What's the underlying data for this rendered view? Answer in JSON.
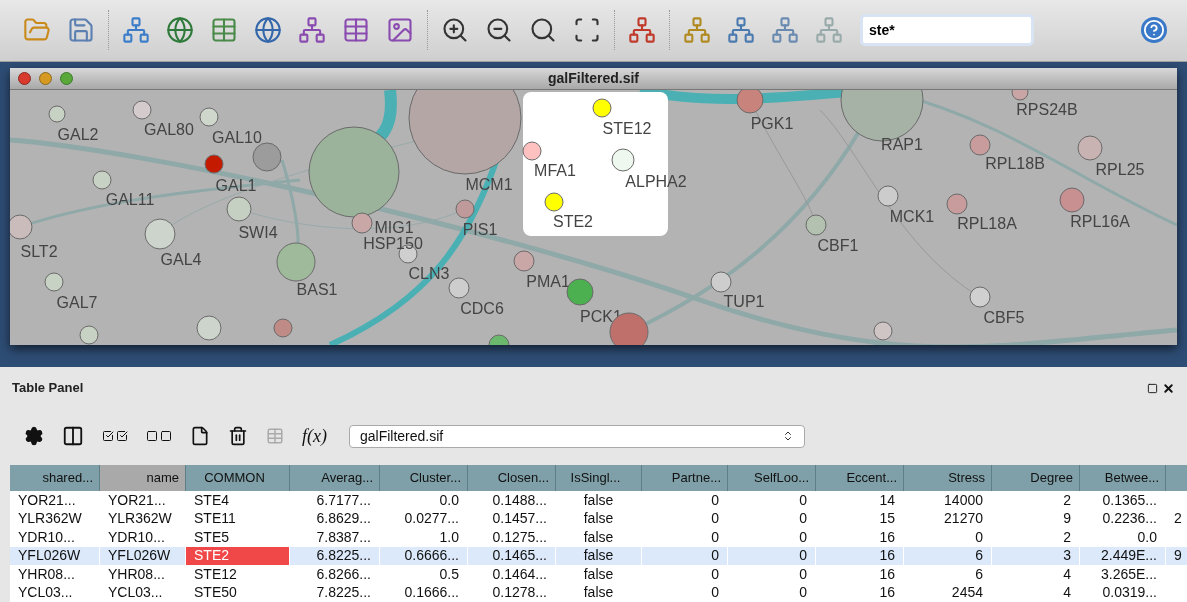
{
  "toolbar": {
    "search": {
      "value": "ste*"
    }
  },
  "network_window": {
    "title": "galFiltered.sif",
    "nodes": [
      {
        "label": "GAL2",
        "color": "#c8d2c4"
      },
      {
        "label": "GAL80",
        "color": "#d4cccc"
      },
      {
        "label": "GAL10",
        "color": "#cfd6cc"
      },
      {
        "color": "#9c9c9c"
      },
      {
        "label": "GAL1",
        "color": "#c41a00"
      },
      {
        "label": "GAL11",
        "color": "#c8d2c4"
      },
      {
        "label": "SWI4",
        "color": "#c5cfc2"
      },
      {
        "label": "GAL4",
        "color": "#cdd4cc"
      },
      {
        "label": "SLT2",
        "color": "#cbbcbc"
      },
      {
        "color": "#9ab39a"
      },
      {
        "label": "MCM1",
        "color": "#b5a6a6"
      },
      {
        "label": "MIG1",
        "color": "#c9a7a7"
      },
      {
        "label": "HSP150",
        "color": "#cfcfcf"
      },
      {
        "label": "PIS1",
        "color": "#c09a9a"
      },
      {
        "label": "BAS1",
        "color": "#9fba9a"
      },
      {
        "label": "CLN3"
      },
      {
        "label": "CDC6",
        "color": "#cdcdcd"
      },
      {
        "label": "GAL7",
        "color": "#c8d2c4"
      },
      {
        "color": "#c8d2c4"
      },
      {
        "color": "#cdd4cc"
      },
      {
        "color": "#c08b86"
      },
      {
        "label": "PMA1",
        "color": "#c9a7a7"
      },
      {
        "label": "PCK1",
        "color": "#4caf50"
      },
      {
        "color": "#6cb86c"
      },
      {
        "color": "#c0706a"
      },
      {
        "label": "MFA1",
        "color": "#ffc0c0"
      },
      {
        "label": "STE2",
        "color": "#ffff00"
      },
      {
        "label": "STE12",
        "color": "#ffff00"
      },
      {
        "label": "ALPHA2",
        "color": "#eef8ee"
      },
      {
        "label": "PGK1",
        "color": "#c8847c"
      },
      {
        "label": "RAP1",
        "color": "#a6b2a6"
      },
      {
        "label": "RPS24B",
        "color": "#caa5a5"
      },
      {
        "label": "RPL18B",
        "color": "#c89c9c"
      },
      {
        "label": "RPL25",
        "color": "#c8b2b2"
      },
      {
        "label": "MCK1",
        "color": "#cccccc"
      },
      {
        "label": "RPL18A",
        "color": "#c89c9c"
      },
      {
        "label": "RPL16A",
        "color": "#c89090"
      },
      {
        "label": "CBF1",
        "color": "#b3c2b0"
      },
      {
        "label": "TUP1",
        "color": "#cdcdcd"
      },
      {
        "label": "CBF5",
        "color": "#d0d0d0"
      },
      {
        "color": "#cfc5c5"
      }
    ]
  },
  "table_panel": {
    "title": "Table Panel",
    "function_label": "f(x)",
    "table_selector": "galFiltered.sif",
    "columns": [
      {
        "label": "shared...",
        "selected": false
      },
      {
        "label": "name",
        "selected": true
      },
      {
        "label": "COMMON",
        "selected": false
      },
      {
        "label": "Averag...",
        "selected": false
      },
      {
        "label": "Cluster...",
        "selected": false
      },
      {
        "label": "Closen...",
        "selected": false
      },
      {
        "label": "IsSingl...",
        "selected": false
      },
      {
        "label": "Partne...",
        "selected": false
      },
      {
        "label": "SelfLoo...",
        "selected": false
      },
      {
        "label": "Eccent...",
        "selected": false
      },
      {
        "label": "Stress",
        "selected": false
      },
      {
        "label": "Degree",
        "selected": false
      },
      {
        "label": "Betwee...",
        "selected": false
      }
    ],
    "rows": [
      {
        "selected": false,
        "common_highlighted": false,
        "cells": [
          "YOR21...",
          "YOR21...",
          "STE4",
          "6.7177...",
          "0.0",
          "0.1488...",
          "false",
          "0",
          "0",
          "14",
          "14000",
          "2",
          "0.1365..."
        ]
      },
      {
        "selected": false,
        "common_highlighted": false,
        "cells": [
          "YLR362W",
          "YLR362W",
          "STE11",
          "6.8629...",
          "0.0277...",
          "0.1457...",
          "false",
          "0",
          "0",
          "15",
          "21270",
          "9",
          "0.2236..."
        ],
        "column_14": "2"
      },
      {
        "selected": false,
        "common_highlighted": false,
        "cells": [
          "YDR10...",
          "YDR10...",
          "STE5",
          "7.8387...",
          "1.0",
          "0.1275...",
          "false",
          "0",
          "0",
          "16",
          "0",
          "2",
          "0.0"
        ]
      },
      {
        "selected": true,
        "common_highlighted": true,
        "cells": [
          "YFL026W",
          "YFL026W",
          "STE2",
          "6.8225...",
          "0.6666...",
          "0.1465...",
          "false",
          "0",
          "0",
          "16",
          "6",
          "3",
          "2.449E..."
        ],
        "column_14": "9"
      },
      {
        "selected": false,
        "common_highlighted": false,
        "cells": [
          "YHR08...",
          "YHR08...",
          "STE12",
          "6.8266...",
          "0.5",
          "0.1464...",
          "false",
          "0",
          "0",
          "16",
          "6",
          "4",
          "3.265E..."
        ]
      },
      {
        "selected": false,
        "common_highlighted": false,
        "cells": [
          "YCL03...",
          "YCL03...",
          "STE50",
          "7.8225...",
          "0.1666...",
          "0.1278...",
          "false",
          "0",
          "0",
          "16",
          "2454",
          "4",
          "0.0319..."
        ]
      }
    ]
  }
}
